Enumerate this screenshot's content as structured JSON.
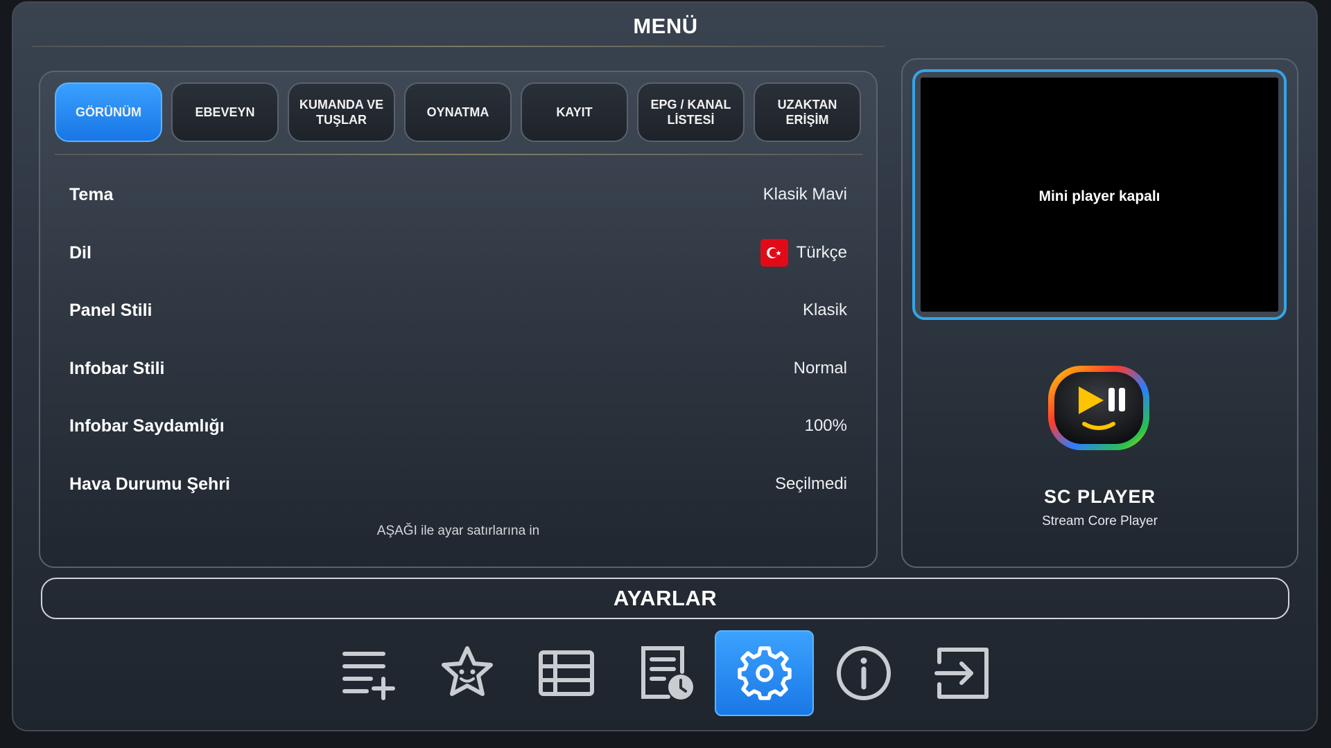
{
  "header": {
    "title": "MENÜ"
  },
  "tabs": [
    {
      "label": "GÖRÜNÜM",
      "active": true
    },
    {
      "label": "EBEVEYN",
      "active": false
    },
    {
      "label": "KUMANDA VE TUŞLAR",
      "active": false
    },
    {
      "label": "OYNATMA",
      "active": false
    },
    {
      "label": "KAYIT",
      "active": false
    },
    {
      "label": "EPG / KANAL LİSTESİ",
      "active": false
    },
    {
      "label": "UZAKTAN ERİŞİM",
      "active": false
    }
  ],
  "settings": [
    {
      "label": "Tema",
      "value": "Klasik Mavi"
    },
    {
      "label": "Dil",
      "value": "Türkçe",
      "icon": "turkey-flag-icon"
    },
    {
      "label": "Panel Stili",
      "value": "Klasik"
    },
    {
      "label": "Infobar Stili",
      "value": "Normal"
    },
    {
      "label": "Infobar Saydamlığı",
      "value": "100%"
    },
    {
      "label": "Hava Durumu Şehri",
      "value": "Seçilmedi"
    }
  ],
  "hint": "AŞAĞI ile ayar satırlarına in",
  "mini_player": {
    "status_text": "Mini player kapalı"
  },
  "app": {
    "name": "SC PLAYER",
    "subtitle": "Stream Core Player",
    "logo_icon": "play-pause-logo-icon"
  },
  "section_bar": {
    "label": "AYARLAR"
  },
  "bottom_nav": [
    {
      "icon": "playlist-add-icon",
      "active": false
    },
    {
      "icon": "star-face-icon",
      "active": false
    },
    {
      "icon": "list-table-icon",
      "active": false
    },
    {
      "icon": "epg-schedule-icon",
      "active": false
    },
    {
      "icon": "gear-icon",
      "active": true
    },
    {
      "icon": "info-icon",
      "active": false
    },
    {
      "icon": "exit-icon",
      "active": false
    }
  ],
  "colors": {
    "accent": "#2a8cf5",
    "mini_border": "#35a4e8",
    "frame_border": "#434a55"
  }
}
